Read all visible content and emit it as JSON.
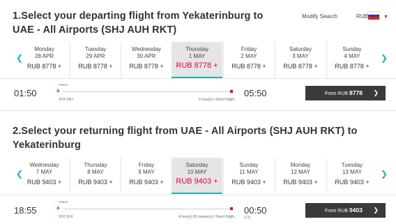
{
  "header": {
    "modify_label": "Modify Search",
    "currency": "RUB",
    "flag": "russia-flag-icon",
    "flag_colors": [
      "#ffffff",
      "#1c3fa5",
      "#d52b1e"
    ]
  },
  "outbound": {
    "title_line1": "1.Select your departing flight from Yekaterinburg to",
    "title_line2": "UAE - All Airports (SHJ AUH RKT)",
    "dates": [
      {
        "day": "Monday",
        "date": "28 APR",
        "price": "RUB 8778 +"
      },
      {
        "day": "Tuesday",
        "date": "29 APR",
        "price": "RUB 8778 +"
      },
      {
        "day": "Wednesday",
        "date": "30 APR",
        "price": "RUB 8778 +"
      },
      {
        "day": "Thursday",
        "date": "1 MAY",
        "price": "RUB 8778 +",
        "selected": true
      },
      {
        "day": "Friday",
        "date": "2 MAY",
        "price": "RUB 8778 +"
      },
      {
        "day": "Saturday",
        "date": "3 MAY",
        "price": "RUB 8778 +"
      },
      {
        "day": "Sunday",
        "date": "4 MAY",
        "price": "RUB 8778 +"
      }
    ],
    "flight": {
      "departure": "01:50",
      "arrival": "05:50",
      "flight_no": "G9941",
      "route": "SVX SHJ",
      "duration": "5 hour(s) / Direct Flight",
      "button_prefix": "From RUB",
      "button_price": "8778"
    }
  },
  "return": {
    "title_line1": "2.Select your returning flight from UAE - All Airports (SHJ AUH RKT) to",
    "title_line2": "Yekaterinburg",
    "dates": [
      {
        "day": "Wednesday",
        "date": "7 MAY",
        "price": "RUB 9403 +"
      },
      {
        "day": "Thursday",
        "date": "8 MAY",
        "price": "RUB 9403 +"
      },
      {
        "day": "Friday",
        "date": "9 MAY",
        "price": "RUB 9403 +"
      },
      {
        "day": "Saturday",
        "date": "10 MAY",
        "price": "RUB 9403 +",
        "selected": true
      },
      {
        "day": "Sunday",
        "date": "11 MAY",
        "price": "RUB 9403 +"
      },
      {
        "day": "Monday",
        "date": "12 MAY",
        "price": "RUB 9403 +"
      },
      {
        "day": "Tuesday",
        "date": "13 MAY",
        "price": "RUB 9403 +"
      }
    ],
    "flight": {
      "departure": "18:55",
      "arrival": "00:50",
      "next_day": "(+1)",
      "flight_no": "G9942",
      "route": "SHJ SVX",
      "duration": "4 hour(s) 55 minute(s) / Direct Flight",
      "button_prefix": "From RUB",
      "button_price": "9403"
    }
  },
  "colors": {
    "accent": "#e0004d",
    "teal": "#1ab2c0",
    "button": "#3a3a3a"
  }
}
